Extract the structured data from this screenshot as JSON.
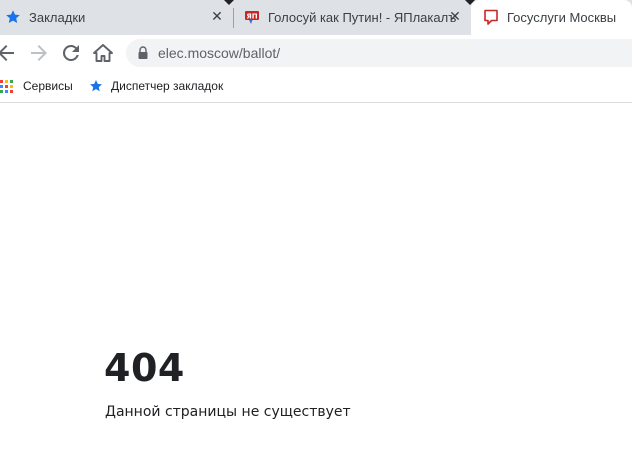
{
  "tabs": [
    {
      "title": "Закладки",
      "favicon": "star-icon",
      "active": false
    },
    {
      "title": "Голосуй как Путин! - ЯПлакалъ",
      "favicon": "yaplakal-icon",
      "active": false
    },
    {
      "title": "Госуслуги Москвы",
      "favicon": "gosuslugi-icon",
      "active": true
    }
  ],
  "toolbar": {
    "address": "elec.moscow/ballot/"
  },
  "bookmarks": [
    {
      "label": "Сервисы",
      "icon": "apps-grid-icon"
    },
    {
      "label": "Диспетчер закладок",
      "icon": "star-icon"
    }
  ],
  "page": {
    "error_code": "404",
    "error_message": "Данной страницы не существует"
  },
  "colors": {
    "tabstrip": "#dee1e6",
    "star_blue": "#1a73e8",
    "gosuslugi_red": "#c62828",
    "text": "#202124"
  }
}
